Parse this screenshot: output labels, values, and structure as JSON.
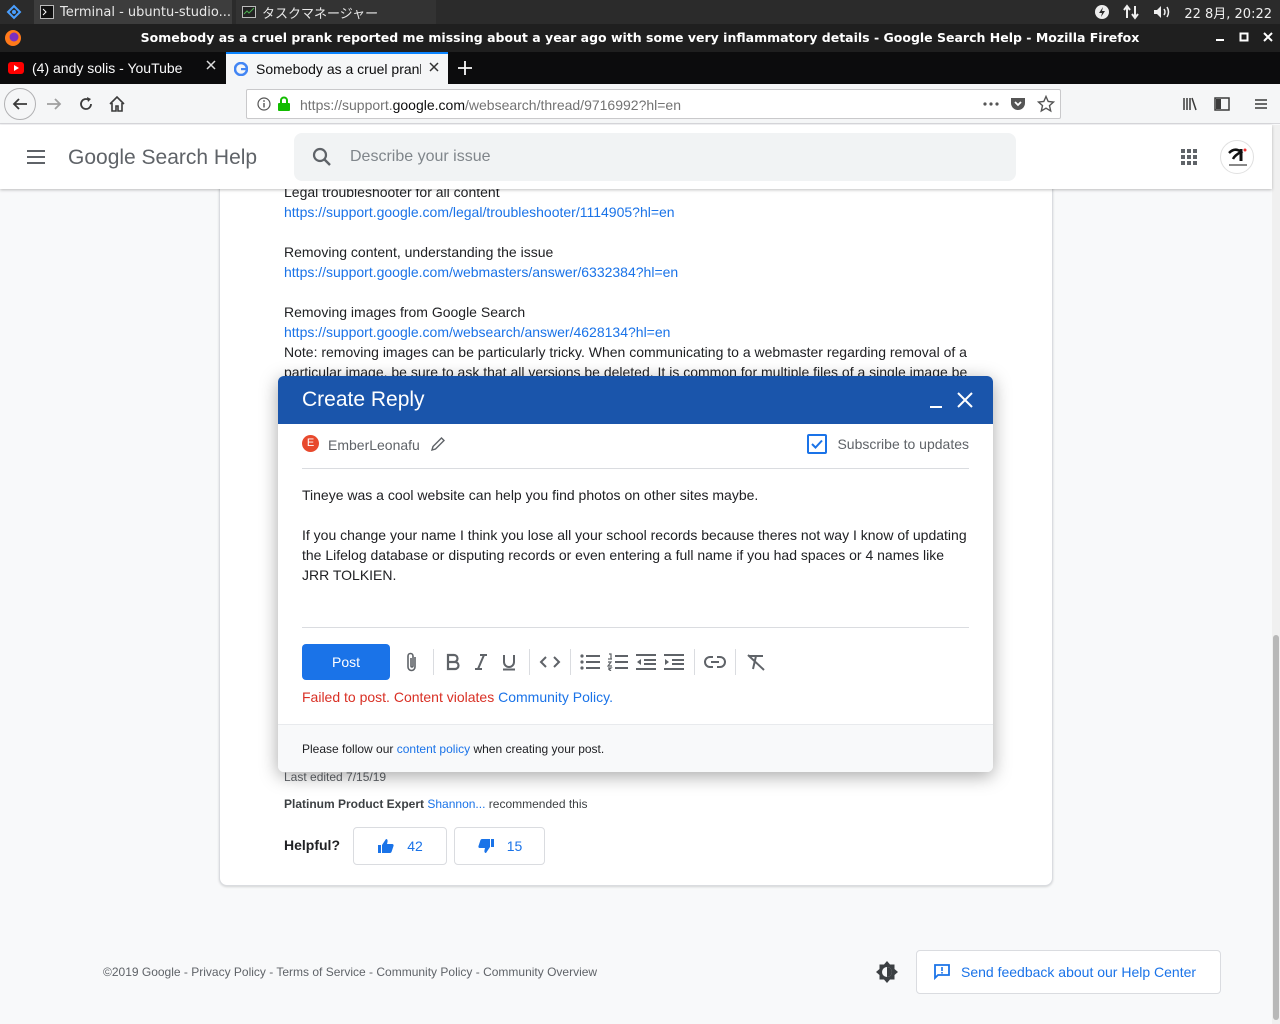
{
  "taskbar": {
    "tasks": [
      {
        "label": "Terminal - ubuntu-studio..."
      },
      {
        "label": "タスクマネージャー"
      }
    ],
    "clock": "22 8月, 20:22"
  },
  "window": {
    "title": "Somebody as a cruel prank reported me missing about a year ago with some very inflammatory details - Google Search Help - Mozilla Firefox"
  },
  "tabs": [
    {
      "label": "(4) andy solis - YouTube"
    },
    {
      "label": "Somebody as a cruel prank"
    }
  ],
  "navbar": {
    "url_prefix": "https://support.",
    "url_domain": "google.com",
    "url_path": "/websearch/thread/9716992?hl=en"
  },
  "help_header": {
    "title": "Google Search Help",
    "search_placeholder": "Describe your issue"
  },
  "thread": {
    "lines": [
      {
        "text": "Legal troubleshooter for all content",
        "link": false
      },
      {
        "text": "https://support.google.com/legal/troubleshooter/1114905?hl=en",
        "link": true
      },
      {
        "text": "Removing content, understanding the issue",
        "link": false
      },
      {
        "text": "https://support.google.com/webmasters/answer/6332384?hl=en",
        "link": true
      },
      {
        "text": "Removing images from Google Search",
        "link": false
      },
      {
        "text": "https://support.google.com/websearch/answer/4628134?hl=en",
        "link": true
      },
      {
        "text": "Note: removing images can be particularly tricky. When communicating to a webmaster regarding removal of a",
        "link": false
      },
      {
        "text": "particular image, be sure to ask that all versions be deleted. It is common for multiple files of a single image be",
        "link": false
      }
    ],
    "last_edited": "Last edited 7/15/19",
    "recommended_prefix": "Platinum Product Expert",
    "recommended_name": "Shannon...",
    "recommended_suffix": "recommended this",
    "helpful_label": "Helpful?",
    "up_count": "42",
    "down_count": "15"
  },
  "dialog": {
    "title": "Create Reply",
    "author_initial": "E",
    "author": "EmberLeonafu",
    "subscribe_label": "Subscribe to updates",
    "body_para1": "Tineye was a cool website can help you find photos on other sites maybe.",
    "body_para2": "If you change your name I think you lose all your school records because theres not way I know of updating the  Lifelog database or disputing records or even entering a full name if you had spaces or 4 names like JRR TOLKIEN.",
    "post_label": "Post",
    "error_text": "Failed to post. Content violates",
    "error_link": "Community Policy.",
    "footer_text": "Please follow our",
    "footer_link": "content policy",
    "footer_suffix": "when creating your post."
  },
  "footer": {
    "links": "©2019 Google - Privacy Policy - Terms of Service - Community Policy - Community Overview",
    "feedback_label": "Send feedback about our Help Center"
  },
  "colors": {
    "accent": "#1a73e8",
    "dialog_header": "#1a55ab",
    "error": "#d93025"
  }
}
